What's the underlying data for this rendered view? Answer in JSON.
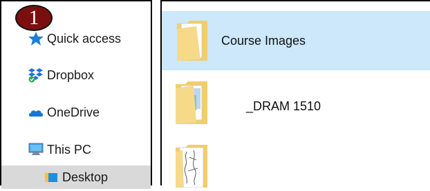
{
  "badge": {
    "number": "1",
    "color": "#7b0f0f"
  },
  "navigation": {
    "items": [
      {
        "label": "Quick access",
        "icon": "quick-access-star-icon"
      },
      {
        "label": "Dropbox",
        "icon": "dropbox-icon"
      },
      {
        "label": "OneDrive",
        "icon": "onedrive-cloud-icon"
      },
      {
        "label": "This PC",
        "icon": "this-pc-monitor-icon"
      },
      {
        "label": "Desktop",
        "icon": "desktop-folder-icon",
        "selected": true
      }
    ]
  },
  "content": {
    "items": [
      {
        "name": "Course Images",
        "icon": "folder-icon",
        "selected": true
      },
      {
        "name": "_DRAM 1510",
        "icon": "folder-icon",
        "selected": false
      },
      {
        "name": "",
        "icon": "folder-with-sketches-icon",
        "selected": false
      }
    ]
  },
  "colors": {
    "selection_blue": "#cce8fa",
    "nav_selected": "#d9d9d9",
    "folder": "#f3cd6a"
  }
}
